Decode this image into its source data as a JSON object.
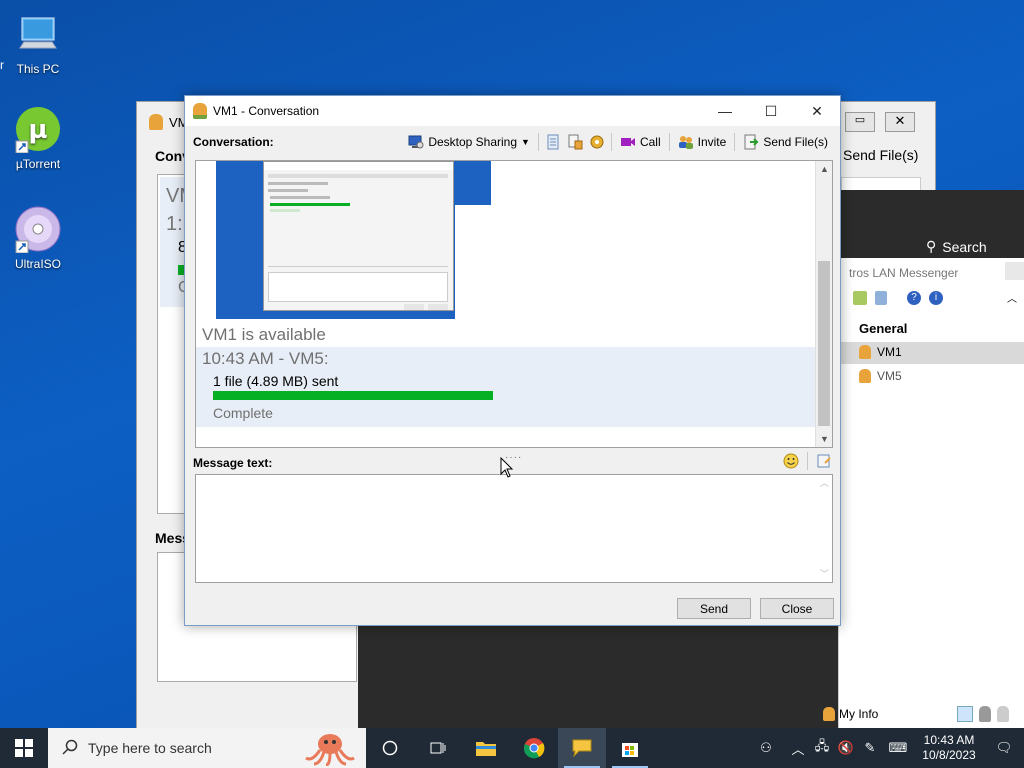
{
  "desktop": {
    "icons": [
      {
        "label": "This PC"
      },
      {
        "label": "µTorrent"
      },
      {
        "label": "UltraISO"
      }
    ]
  },
  "background_windows": {
    "left_win": {
      "title": "VM",
      "conv_label": "Conv",
      "lines": [
        "VM",
        "1:",
        "8",
        "C"
      ],
      "msg_label": "Mess"
    },
    "right_partial": {
      "send_files": "Send File(s)"
    },
    "dark_search": "Search",
    "lan": {
      "title": "tros LAN Messenger",
      "group": "General",
      "contacts": [
        "VM1",
        "VM5"
      ],
      "my_info": "My Info"
    }
  },
  "window": {
    "title": "VM1 - Conversation",
    "toolbar": {
      "conversation_label": "Conversation:",
      "desktop_sharing": "Desktop Sharing",
      "call": "Call",
      "invite": "Invite",
      "send_files": "Send File(s)"
    },
    "conversation": {
      "status": "VM1 is available",
      "timestamp": "10:43 AM - VM5:",
      "file_line": "1 file (4.89 MB) sent",
      "progress": 1.0,
      "complete": "Complete"
    },
    "message_text_label": "Message text:",
    "input_value": "",
    "send_button": "Send",
    "close_button": "Close"
  },
  "taskbar": {
    "search_placeholder": "Type here to search",
    "time": "10:43 AM",
    "date": "10/8/2023"
  },
  "colors": {
    "progress_fill": "#06b025",
    "desktop": "#0d5fc4",
    "taskbar": "#1f2a36"
  }
}
